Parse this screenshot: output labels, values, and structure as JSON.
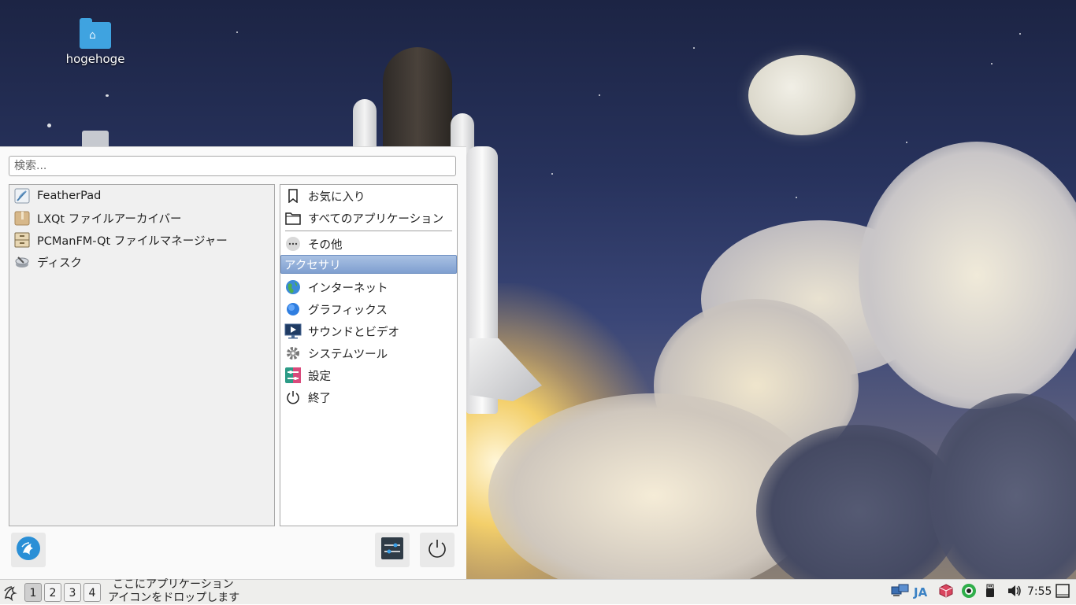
{
  "desktop": {
    "icons": [
      {
        "label": "hogehoge"
      },
      {
        "label": ""
      }
    ]
  },
  "menu": {
    "search": {
      "placeholder": "検索..."
    },
    "apps": [
      {
        "label": "FeatherPad",
        "icon": "featherpad-icon"
      },
      {
        "label": "LXQt ファイルアーカイバー",
        "icon": "archiver-icon"
      },
      {
        "label": "PCManFM-Qt ファイルマネージャー",
        "icon": "file-manager-icon"
      },
      {
        "label": "ディスク",
        "icon": "disk-icon"
      }
    ],
    "categories": [
      {
        "label": "お気に入り",
        "icon": "bookmark-icon"
      },
      {
        "label": "すべてのアプリケーション",
        "icon": "folder-outline-icon"
      },
      {
        "label": "その他",
        "icon": "more-icon"
      },
      {
        "label": "アクセサリ",
        "icon": "",
        "selected": true
      },
      {
        "label": "インターネット",
        "icon": "globe-icon"
      },
      {
        "label": "グラフィックス",
        "icon": "graphics-icon"
      },
      {
        "label": "サウンドとビデオ",
        "icon": "monitor-play-icon"
      },
      {
        "label": "システムツール",
        "icon": "gear-icon"
      },
      {
        "label": "設定",
        "icon": "settings-icon"
      },
      {
        "label": "終了",
        "icon": "power-icon"
      }
    ]
  },
  "taskbar": {
    "workspaces": [
      "1",
      "2",
      "3",
      "4"
    ],
    "active_workspace": "1",
    "quicklaunch_text_1": "ここにアプリケーション",
    "quicklaunch_text_2": "アイコンをドロップします",
    "input_method": "JA",
    "clock": "7:55"
  },
  "colors": {
    "selection": "#7f9fd0",
    "menu_bg": "#fafafa",
    "taskbar_bg": "#eeeeec",
    "lxqt_blue": "#2a8fd6"
  }
}
